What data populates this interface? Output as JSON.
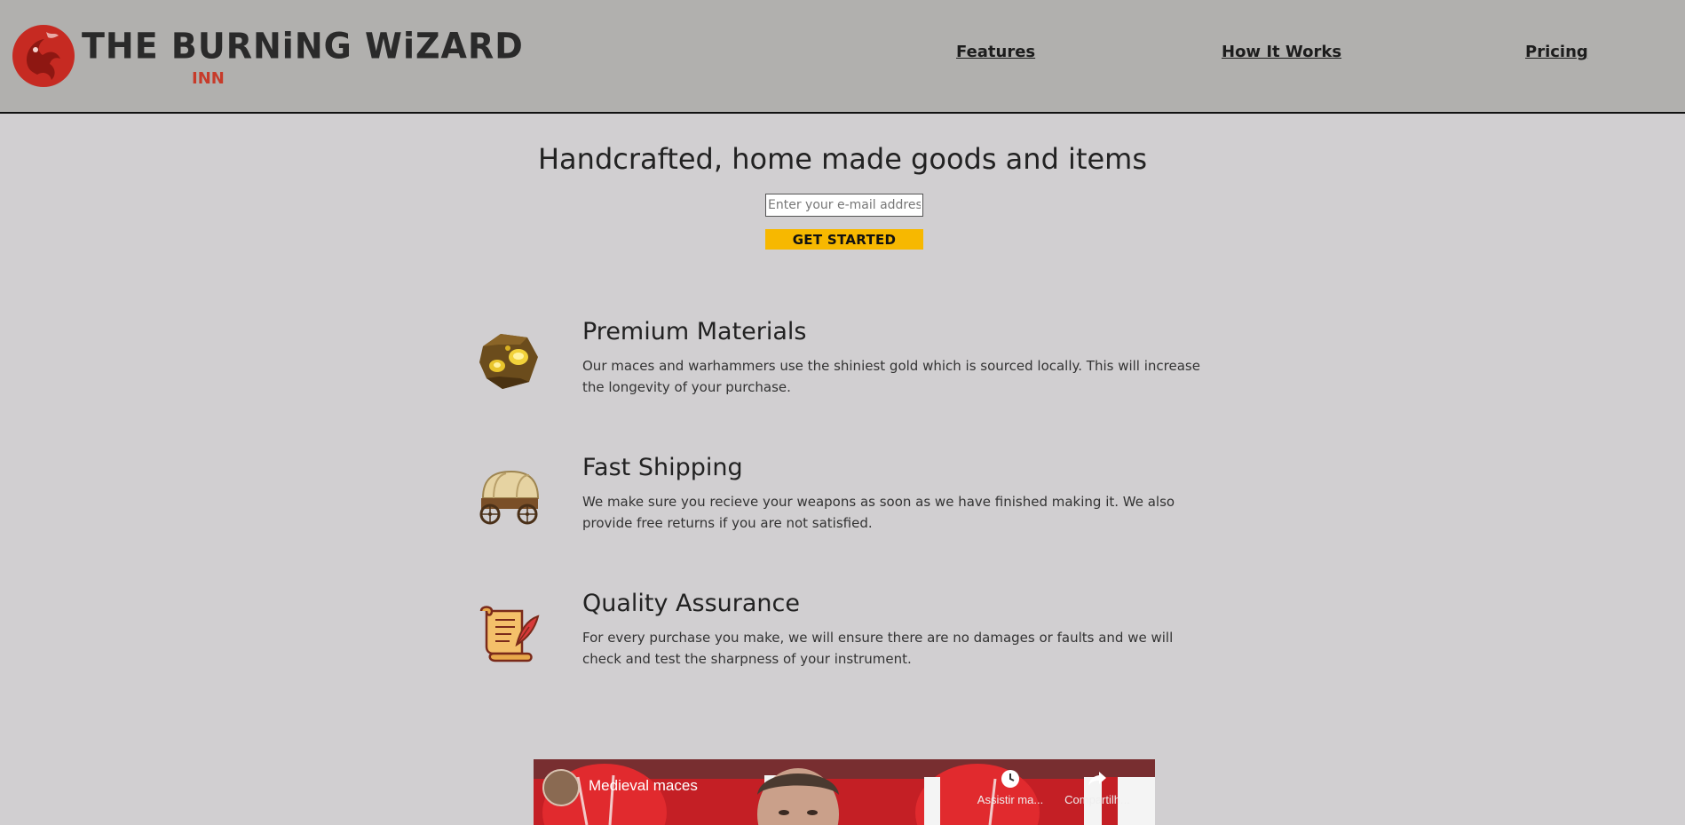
{
  "brand": {
    "title": "THE BURNiNG WiZARD",
    "subtitle": "INN"
  },
  "nav": {
    "items": [
      {
        "label": "Features",
        "name": "nav-features"
      },
      {
        "label": "How It Works",
        "name": "nav-how-it-works"
      },
      {
        "label": "Pricing",
        "name": "nav-pricing"
      }
    ]
  },
  "hero": {
    "title": "Handcrafted, home made goods and items",
    "email_placeholder": "Enter your e-mail address",
    "cta_label": "GET STARTED"
  },
  "features": [
    {
      "icon": "gold-ore-icon",
      "title": "Premium Materials",
      "description": "Our maces and warhammers use the shiniest gold which is sourced locally. This will increase the longevity of your purchase."
    },
    {
      "icon": "wagon-icon",
      "title": "Fast Shipping",
      "description": "We make sure you recieve your weapons as soon as we have finished making it. We also provide free returns if you are not satisfied."
    },
    {
      "icon": "scroll-quill-icon",
      "title": "Quality Assurance",
      "description": "For every purchase you make, we will ensure there are no damages or faults and we will check and test the sharpness of your instrument."
    }
  ],
  "video": {
    "title": "Medieval maces",
    "actions": [
      {
        "label": "Assistir ma...",
        "icon": "clock-icon"
      },
      {
        "label": "Compartilh...",
        "icon": "share-icon"
      }
    ]
  },
  "colors": {
    "header_bg": "#b1b0ae",
    "page_bg": "#d1cfd1",
    "cta": "#f7b800",
    "brand_red": "#c73b2a"
  }
}
